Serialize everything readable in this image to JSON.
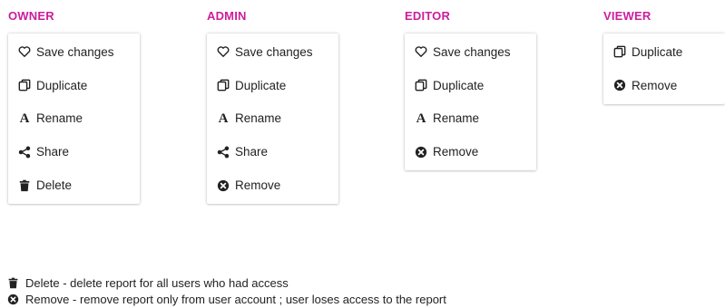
{
  "roles": [
    {
      "title": "OWNER",
      "items": [
        {
          "icon": "heart-icon",
          "label": "Save changes"
        },
        {
          "icon": "duplicate-icon",
          "label": "Duplicate"
        },
        {
          "icon": "rename-icon",
          "label": "Rename"
        },
        {
          "icon": "share-icon",
          "label": "Share"
        },
        {
          "icon": "trash-icon",
          "label": "Delete"
        }
      ]
    },
    {
      "title": "ADMIN",
      "items": [
        {
          "icon": "heart-icon",
          "label": "Save changes"
        },
        {
          "icon": "duplicate-icon",
          "label": "Duplicate"
        },
        {
          "icon": "rename-icon",
          "label": "Rename"
        },
        {
          "icon": "share-icon",
          "label": "Share"
        },
        {
          "icon": "remove-icon",
          "label": "Remove"
        }
      ]
    },
    {
      "title": "EDITOR",
      "items": [
        {
          "icon": "heart-icon",
          "label": "Save changes"
        },
        {
          "icon": "duplicate-icon",
          "label": "Duplicate"
        },
        {
          "icon": "rename-icon",
          "label": "Rename"
        },
        {
          "icon": "remove-icon",
          "label": "Remove"
        }
      ]
    },
    {
      "title": "VIEWER",
      "items": [
        {
          "icon": "duplicate-icon",
          "label": "Duplicate"
        },
        {
          "icon": "remove-icon",
          "label": "Remove"
        }
      ]
    }
  ],
  "legend": {
    "delete_text": "Delete - delete report for all users who had access",
    "remove_text": "Remove - remove report only from user account ; user loses access to the report"
  },
  "colors": {
    "role_title": "#cc1d9c",
    "text": "#1f1f1f"
  }
}
